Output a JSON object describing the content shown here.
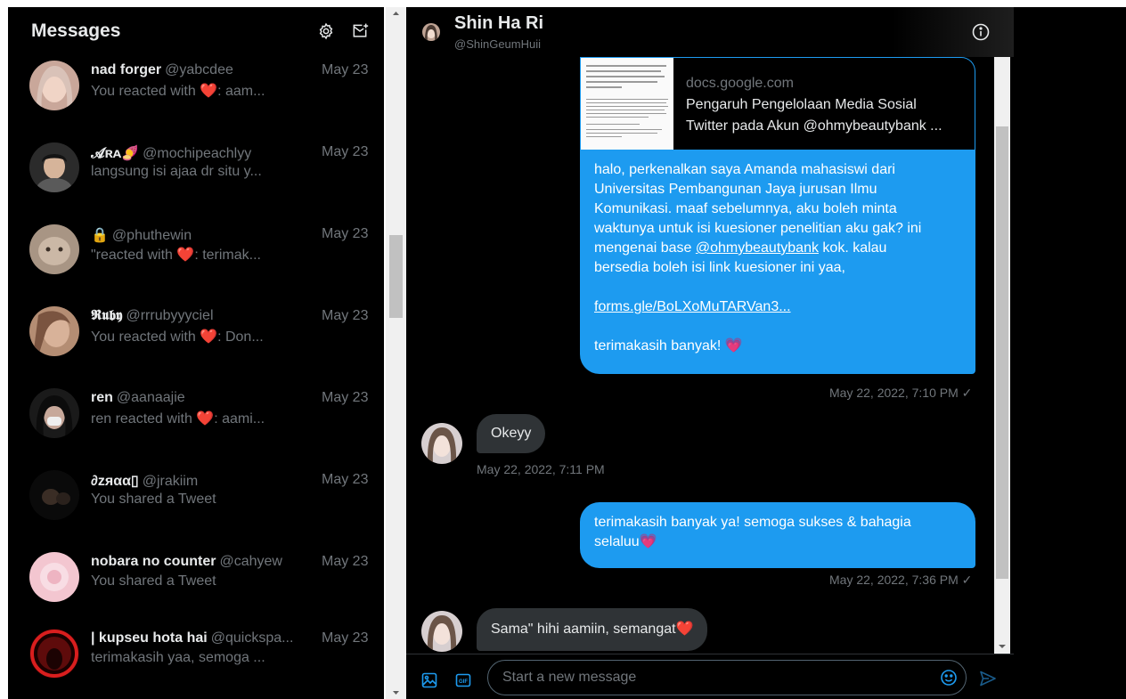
{
  "sidebar": {
    "title": "Messages",
    "conversations": [
      {
        "name": "nad forger",
        "handle": "@yabcdee",
        "date": "May 23",
        "preview": "You reacted with ❤️: aam..."
      },
      {
        "name": "𝓐ʀᴀ🍠",
        "handle": "@mochipeachlyy",
        "date": "May 23",
        "preview": "langsung isi ajaa dr situ y..."
      },
      {
        "name": "🔒",
        "handle": "@phuthewin",
        "date": "May 23",
        "preview": "\"reacted with ❤️: terimak..."
      },
      {
        "name": "𝕽𝖚𝖇𝖞",
        "handle": "@rrrubyyyciel",
        "date": "May 23",
        "preview": "You reacted with ❤️: Don..."
      },
      {
        "name": "ren",
        "handle": "@aanaajie",
        "date": "May 23",
        "preview": "ren reacted with ❤️: aami..."
      },
      {
        "name": "∂zяαα▯",
        "handle": "@jrakiim",
        "date": "May 23",
        "preview": "You shared a Tweet"
      },
      {
        "name": "nobara no counter",
        "handle": "@cahyew",
        "date": "May 23",
        "preview": "You shared a Tweet"
      },
      {
        "name": "| kupseu hota hai",
        "handle": "@quickspa...",
        "date": "May 23",
        "preview": "terimakasih yaa, semoga ..."
      }
    ]
  },
  "chat": {
    "name": "Shin Ha Ri",
    "handle": "@ShinGeumHuii",
    "link_card": {
      "domain": "docs.google.com",
      "title_line1": "Pengaruh Pengelolaan Media Sosial",
      "title_line2": "Twitter pada Akun @ohmybeautybank ..."
    },
    "messages": {
      "m1_lines": [
        "halo, perkenalkan saya Amanda mahasiswi dari",
        "Universitas Pembangunan Jaya jurusan Ilmu",
        "Komunikasi. maaf sebelumnya, aku boleh minta",
        "waktunya untuk isi kuesioner penelitian aku gak? ini",
        "mengenai base ",
        "@ohmybeautybank",
        " kok. kalau",
        "bersedia boleh isi link kuesioner ini yaa,"
      ],
      "m1_link": "forms.gle/BoLXoMuTARVan3...",
      "m1_closing": "terimakasih banyak! 💗",
      "m1_time": "May 22, 2022, 7:10 PM ✓",
      "m2_text": "Okeyy",
      "m2_time": "May 22, 2022, 7:11 PM",
      "m3_line1": "terimakasih banyak ya! semoga sukses & bahagia",
      "m3_line2": "selaluu💗",
      "m3_time": "May 22, 2022, 7:36 PM ✓",
      "m4_text": "Sama\" hihi aamiin, semangat❤️"
    },
    "composer": {
      "placeholder": "Start a new message",
      "gif_label": "GIF"
    }
  },
  "colors": {
    "accent": "#1d9bf0",
    "incoming_bubble": "#2f3336",
    "muted": "#71767b",
    "background": "#000000"
  },
  "icons": [
    "gear-icon",
    "new-message-icon",
    "info-icon",
    "image-icon",
    "gif-icon",
    "emoji-icon",
    "send-icon"
  ]
}
